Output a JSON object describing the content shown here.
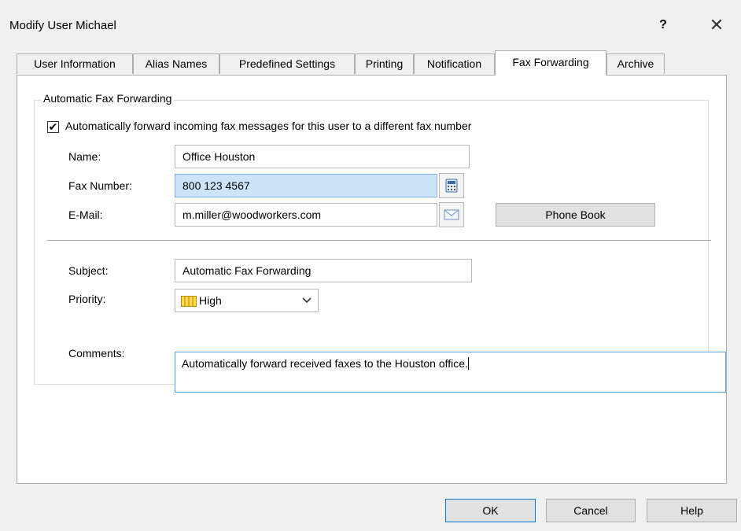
{
  "window": {
    "title": "Modify User Michael",
    "help_label": "?",
    "close_label": "✕"
  },
  "tabs": [
    {
      "label": "User Information"
    },
    {
      "label": "Alias Names"
    },
    {
      "label": "Predefined Settings"
    },
    {
      "label": "Printing"
    },
    {
      "label": "Notification"
    },
    {
      "label": "Fax Forwarding",
      "active": true
    },
    {
      "label": "Archive"
    }
  ],
  "group": {
    "title": "Automatic Fax Forwarding",
    "checkbox_label": "Automatically forward incoming fax messages for this user to a different fax number",
    "checkbox_checked": true,
    "checkmark": "✔"
  },
  "form": {
    "name_label": "Name:",
    "name_value": "Office Houston",
    "fax_label": "Fax Number:",
    "fax_value": "800 123 4567",
    "email_label": "E-Mail:",
    "email_value": "m.miller@woodworkers.com",
    "phonebook_label": "Phone Book",
    "subject_label": "Subject:",
    "subject_value": "Automatic Fax Forwarding",
    "priority_label": "Priority:",
    "priority_value": "High",
    "comments_label": "Comments:",
    "comments_value": "Automatically forward received faxes to the Houston office."
  },
  "footer": {
    "ok_label": "OK",
    "cancel_label": "Cancel",
    "help_label": "Help"
  },
  "icons": {
    "fax": "fax-machine-icon",
    "email": "envelope-icon",
    "priority": "priority-high-icon"
  },
  "colors": {
    "accent": "#0078d7",
    "focus_field": "#cce4f7",
    "priority_icon": "#e8b500"
  }
}
